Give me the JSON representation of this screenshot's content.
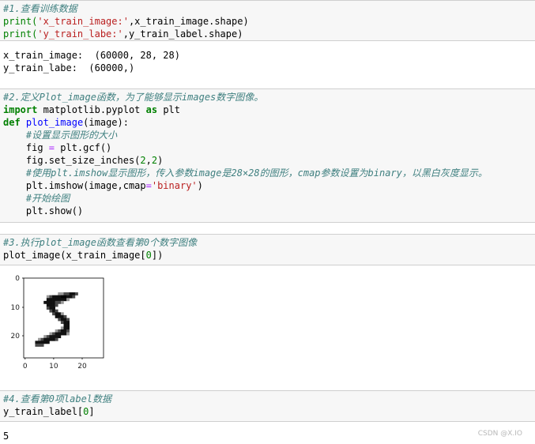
{
  "cell1": {
    "comment": "#1.查看训练数据",
    "line2": [
      "print(",
      "'x_train_image:'",
      ",x_train_image.shape)"
    ],
    "line3": [
      "print(",
      "'y_train_labe:'",
      ",y_train_label.shape)"
    ]
  },
  "out1": {
    "line1": "x_train_image:  (60000, 28, 28)",
    "line2": "y_train_labe:  (60000,)"
  },
  "cell2": {
    "comment1": "#2.定义Plot_image函数，为了能够显示images数字图像。",
    "import_kw": "import",
    "import_mod": " matplotlib.pyplot ",
    "as_kw": "as",
    "import_alias": " plt",
    "def_kw": "def",
    "def_name": "plot_image",
    "def_args": "(image):",
    "comment2": "    #设置显示图形的大小",
    "fig_a": "    fig ",
    "fig_eq": "=",
    "fig_b": " plt.gcf()",
    "set_a": "    fig.set_size_inches(",
    "set_n1": "2",
    "set_comma": ",",
    "set_n2": "2",
    "set_c": ")",
    "comment3": "    #使用plt.imshow显示图形，传入参数image是28×28的图形，cmap参数设置为binary，以黑白灰度显示。",
    "imshow_a": "    plt.imshow(image,cmap",
    "imshow_eq": "=",
    "imshow_str": "'binary'",
    "imshow_c": ")",
    "comment4": "    #开始绘图",
    "show": "    plt.show()"
  },
  "cell3": {
    "comment": "#3.执行plot_image函数查看第0个数字图像",
    "call_a": "plot_image(x_train_image[",
    "call_n": "0",
    "call_c": "])"
  },
  "plot": {
    "y_ticks": [
      "0",
      "10",
      "20"
    ],
    "x_ticks": [
      "0",
      "10",
      "20"
    ],
    "cmap": "binary",
    "digit": "5"
  },
  "cell4": {
    "comment": "#4.查看第0项label数据",
    "call_a": "y_train_label[",
    "call_n": "0",
    "call_c": "]"
  },
  "out4": {
    "value": "5"
  },
  "watermark": "CSDN @X.IO"
}
